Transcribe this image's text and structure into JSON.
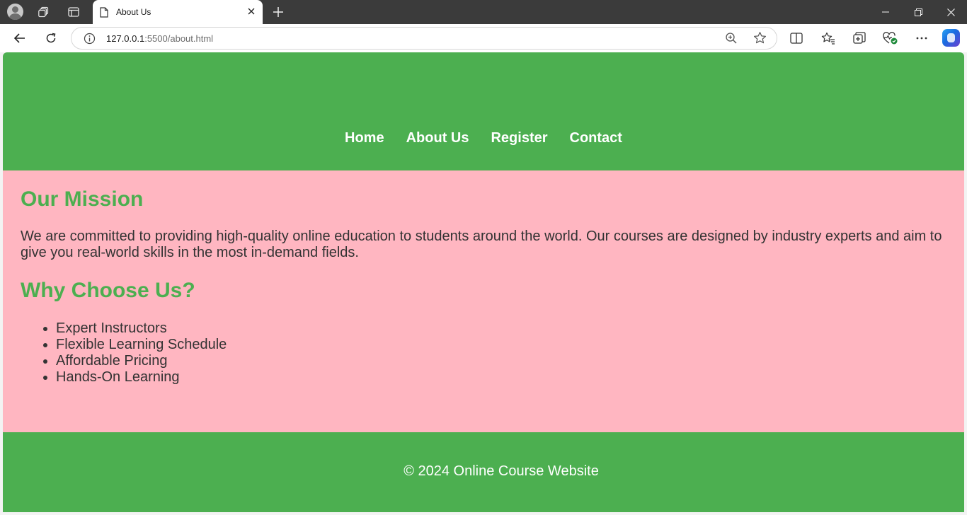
{
  "browser": {
    "tab": {
      "title": "About Us"
    },
    "address_bar": {
      "host": "127.0.0.1",
      "path": ":5500/about.html"
    }
  },
  "site": {
    "nav": [
      "Home",
      "About Us",
      "Register",
      "Contact"
    ],
    "mission": {
      "heading": "Our Mission",
      "text": "We are committed to providing high-quality online education to students around the world. Our courses are designed by industry experts and aim to give you real-world skills in the most in-demand fields."
    },
    "why": {
      "heading": "Why Choose Us?",
      "items": [
        "Expert Instructors",
        "Flexible Learning Schedule",
        "Affordable Pricing",
        "Hands-On Learning"
      ]
    },
    "footer": {
      "copyright": "© 2024 Online Course Website"
    }
  },
  "colors": {
    "header_footer": "#4caf50",
    "content_bg": "#ffb6c1",
    "heading": "#4caf50",
    "text": "#333333",
    "tab_strip": "#3b3b3b"
  }
}
